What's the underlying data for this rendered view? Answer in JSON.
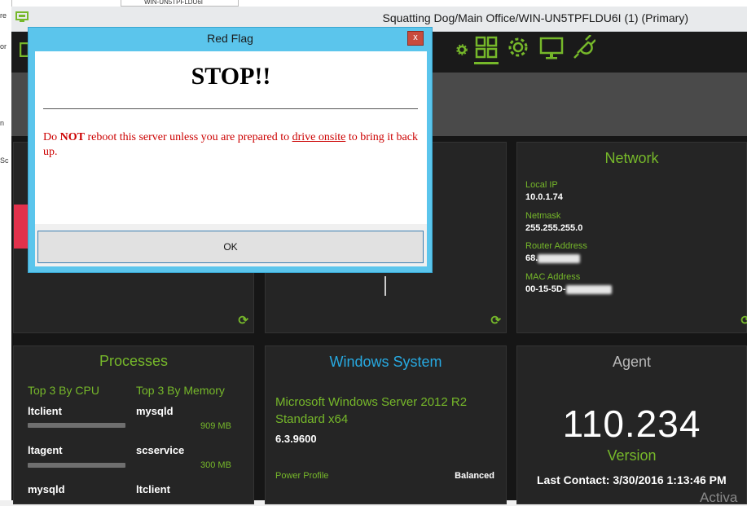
{
  "background_window": {
    "tab_label": "WIN-UN5TPFLDU6I",
    "side_labels": [
      "re",
      "or",
      "n",
      "Sc"
    ]
  },
  "window": {
    "title": "Squatting Dog/Main Office/WIN-UN5TPFLDU6I (1) (Primary)"
  },
  "header": {
    "icons": [
      "gear-small-icon",
      "grid-icon",
      "gear-icon",
      "monitor-icon",
      "plug-icon"
    ]
  },
  "dialog": {
    "title": "Red Flag",
    "close_label": "x",
    "heading": "STOP!!",
    "message_part1": "Do ",
    "message_bold": "NOT",
    "message_part2": " reboot this server unless you are prepared to ",
    "message_link": "drive onsite",
    "message_part3": " to bring it back up.",
    "ok_label": "OK"
  },
  "network": {
    "title": "Network",
    "local_ip_label": "Local IP",
    "local_ip": "10.0.1.74",
    "netmask_label": "Netmask",
    "netmask": "255.255.255.0",
    "router_label": "Router Address",
    "router_prefix": "68.",
    "mac_label": "MAC Address",
    "mac_prefix": "00-15-5D-"
  },
  "processes": {
    "title": "Processes",
    "cpu_header": "Top 3 By CPU",
    "mem_header": "Top 3 By Memory",
    "cpu": [
      {
        "name": "ltclient"
      },
      {
        "name": "ltagent"
      },
      {
        "name": "mysqld"
      }
    ],
    "memory": [
      {
        "name": "mysqld",
        "value": "909 MB"
      },
      {
        "name": "scservice",
        "value": "300 MB"
      },
      {
        "name": "ltclient",
        "value": ""
      }
    ]
  },
  "windows_system": {
    "title": "Windows System",
    "os_name": "Microsoft Windows Server 2012 R2 Standard x64",
    "version": "6.3.9600",
    "power_label": "Power Profile",
    "power_value": "Balanced"
  },
  "agent": {
    "title": "Agent",
    "version": "110.234",
    "version_label": "Version",
    "last_contact": "Last Contact: 3/30/2016 1:13:46 PM",
    "watermark": "Activa"
  },
  "colors": {
    "accent_green": "#76b82a",
    "accent_blue": "#27a9e1",
    "dialog_frame": "#5bc5ec",
    "alert_red": "#cc0000",
    "side_red": "#e2314c"
  }
}
